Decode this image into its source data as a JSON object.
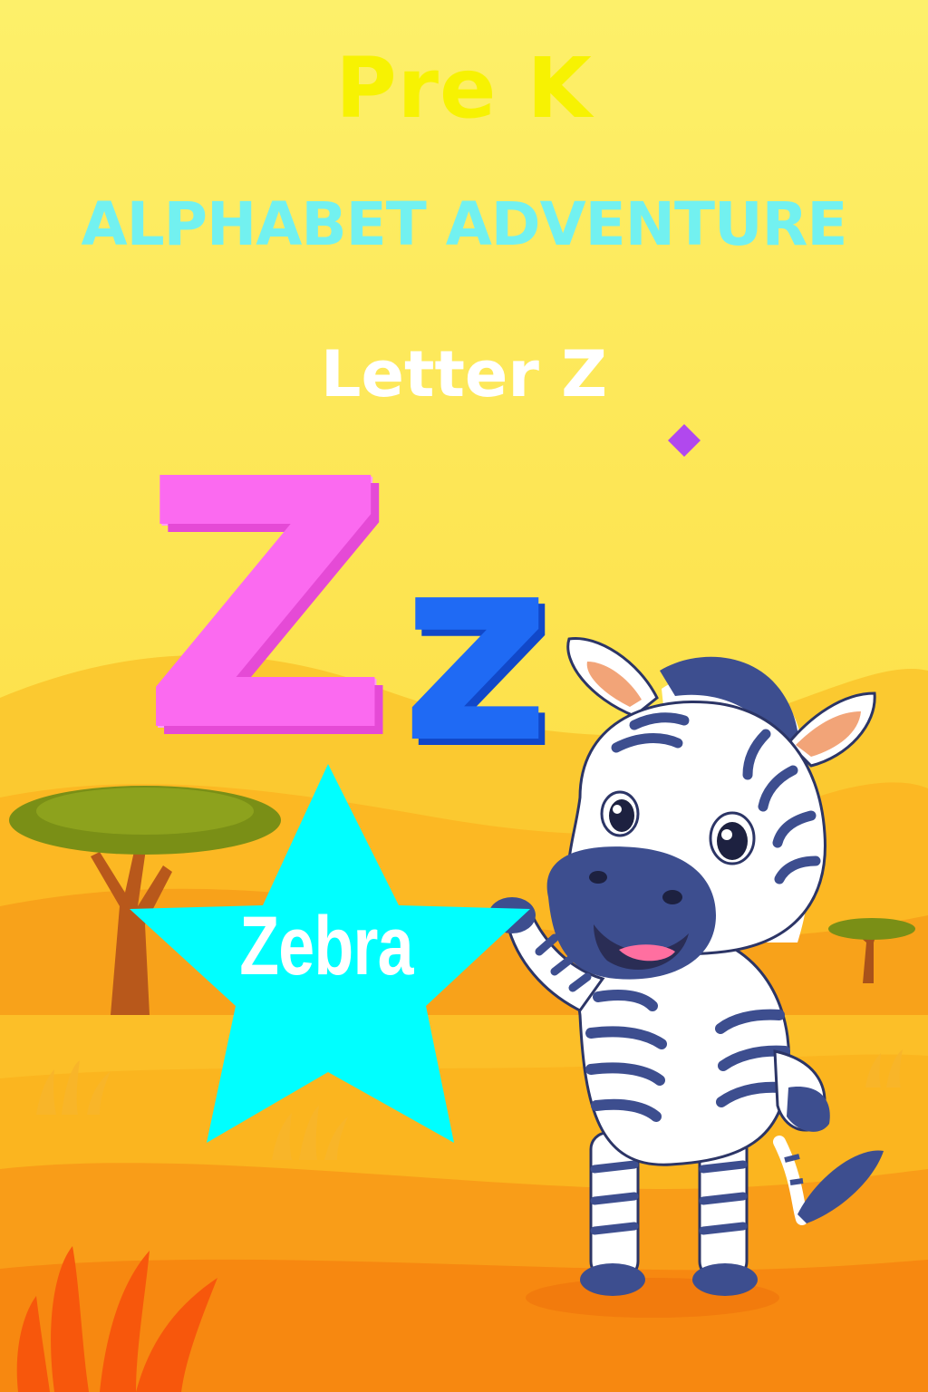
{
  "header": {
    "level": "Pre K",
    "title": "ALPHABET ADVENTURE",
    "letter_line": "Letter Z"
  },
  "letters": {
    "uppercase": "Z",
    "lowercase": "z"
  },
  "word": {
    "label": "Zebra",
    "animal": "zebra"
  },
  "colors": {
    "background_top": "#fdf06a",
    "background_bottom": "#ff8a0c",
    "pre_k": "#f7f202",
    "title": "#72f1f0",
    "letter_line": "#ffffff",
    "uppercase": "#fb6af0",
    "lowercase": "#1f6af4",
    "star": "#00ffff",
    "zebra_stripes": "#3d4e8f"
  }
}
